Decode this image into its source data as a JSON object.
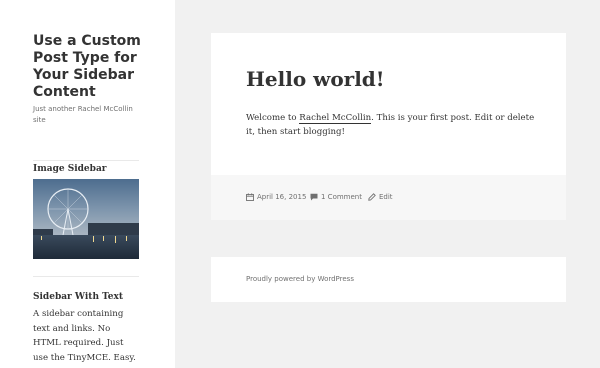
{
  "site": {
    "title": "Use a Custom Post Type for Your Sidebar Content",
    "description": "Just another Rachel McCollin site"
  },
  "widgets": [
    {
      "title": "Image Sidebar",
      "image_icon": "london-eye-photo"
    },
    {
      "title": "Sidebar With Text",
      "text": "A sidebar containing text and links. No HTML required. Just use the TinyMCE. Easy."
    }
  ],
  "post": {
    "title": "Hello world!",
    "body_before": "Welcome to ",
    "body_link": "Rachel McCollin",
    "body_after": ". This is your first post. Edit or delete it, then start blogging!",
    "date": "April 16, 2015",
    "comments": "1 Comment",
    "edit": "Edit",
    "icons": {
      "date": "calendar-icon",
      "comments": "comment-icon",
      "edit": "pencil-icon"
    }
  },
  "footer": {
    "powered": "Proudly powered by WordPress"
  },
  "colors": {
    "background": "#f1f1f1",
    "card": "#ffffff",
    "meta_bar": "#f7f7f7",
    "text": "#333333",
    "muted": "#707070"
  }
}
